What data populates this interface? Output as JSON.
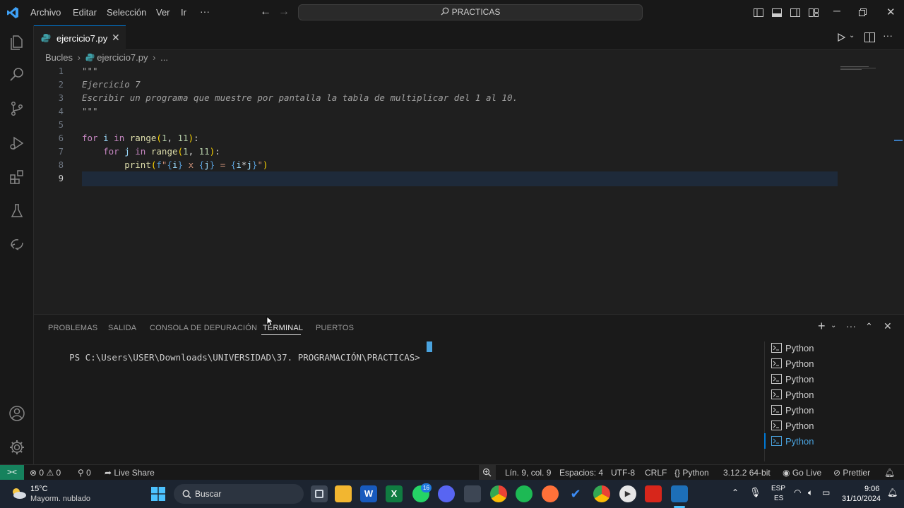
{
  "menu": {
    "archivo": "Archivo",
    "editar": "Editar",
    "seleccion": "Selección",
    "ver": "Ver",
    "ir": "Ir",
    "more": "···"
  },
  "command_center": {
    "text": "PRACTICAS"
  },
  "tab": {
    "label": "ejercicio7.py"
  },
  "breadcrumb": {
    "folder": "Bucles",
    "file": "ejercicio7.py",
    "more": "..."
  },
  "code": {
    "line_numbers": [
      "1",
      "2",
      "3",
      "4",
      "5",
      "6",
      "7",
      "8",
      "9"
    ],
    "l1": "\"\"\"",
    "l2": "Ejercicio 7",
    "l3": "Escribir un programa que muestre por pantalla la tabla de multiplicar del 1 al 10.",
    "l4": "\"\"\""
  },
  "panel": {
    "tabs": [
      "PROBLEMAS",
      "SALIDA",
      "CONSOLA DE DEPURACIÓN",
      "TERMINAL",
      "PUERTOS"
    ],
    "prompt": "PS C:\\Users\\USER\\Downloads\\UNIVERSIDAD\\37. PROGRAMACIÓN\\PRACTICAS>",
    "terminals": [
      "Python",
      "Python",
      "Python",
      "Python",
      "Python",
      "Python",
      "Python"
    ]
  },
  "status": {
    "errors": "0",
    "warnings": "0",
    "ports": "0",
    "live_share": "Live Share",
    "position": "Lín. 9, col. 9",
    "spaces": "Espacios: 4",
    "encoding": "UTF-8",
    "eol": "CRLF",
    "language": "Python",
    "interpreter": "3.12.2 64-bit",
    "go_live": "Go Live",
    "prettier": "Prettier"
  },
  "taskbar": {
    "weather_temp": "15°C",
    "weather_desc": "Mayorm. nublado",
    "search": "Buscar",
    "badge": "16",
    "lang1": "ESP",
    "lang2": "ES",
    "time": "9:06",
    "date": "31/10/2024"
  },
  "colors": {
    "accent": "#0078d4",
    "remote": "#16825d",
    "editor_bg": "#1f1f1f",
    "current_line": "#1e2a3a"
  }
}
